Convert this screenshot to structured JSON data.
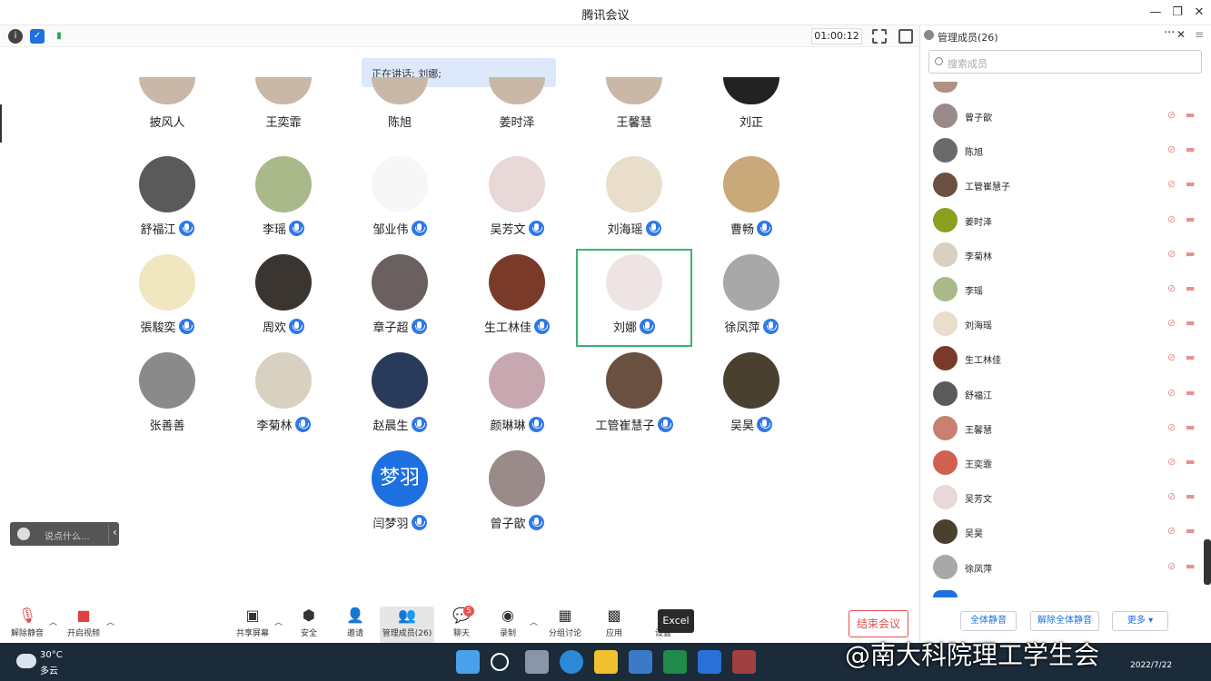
{
  "window": {
    "title": "腾讯会议"
  },
  "toolbar": {
    "timer": "01:00:12"
  },
  "speaking": {
    "text": "正在讲话: 刘娜;"
  },
  "partial_row": [
    {
      "name": "披风人",
      "mic": true
    },
    {
      "name": "王奕霏",
      "mic": true
    },
    {
      "name": "陈旭",
      "mic": true
    },
    {
      "name": "姜时泽",
      "mic": true
    },
    {
      "name": "王馨慧",
      "mic": true
    },
    {
      "name": "刘正",
      "mic": false
    }
  ],
  "grid": [
    {
      "name": "舒福江",
      "mic": true,
      "color": "#5a5a5a"
    },
    {
      "name": "李瑶",
      "mic": true,
      "color": "#a9b98a"
    },
    {
      "name": "邹业伟",
      "mic": true,
      "color": "#f7f7f7"
    },
    {
      "name": "吴芳文",
      "mic": true,
      "color": "#e8d8d8"
    },
    {
      "name": "刘海瑶",
      "mic": true,
      "color": "#e9ddcc"
    },
    {
      "name": "曹畅",
      "mic": true,
      "color": "#c9a87a"
    },
    {
      "name": "張駿奕",
      "mic": true,
      "color": "#f0e6c0"
    },
    {
      "name": "周欢",
      "mic": true,
      "color": "#3a3530"
    },
    {
      "name": "章子超",
      "mic": true,
      "color": "#6a6060"
    },
    {
      "name": "生工林佳",
      "mic": true,
      "color": "#7a3a2a"
    },
    {
      "name": "刘娜",
      "mic": true,
      "color": "#eee4e4"
    },
    {
      "name": "徐凤萍",
      "mic": true,
      "color": "#a8a8a8"
    },
    {
      "name": "张善善",
      "mic": false,
      "color": "#8a8a8a"
    },
    {
      "name": "李菊林",
      "mic": true,
      "color": "#d8d0c0"
    },
    {
      "name": "赵晨生",
      "mic": true,
      "color": "#2a3a5a"
    },
    {
      "name": "颜琳琳",
      "mic": true,
      "color": "#c8a8b0"
    },
    {
      "name": "工管崔慧子",
      "mic": true,
      "color": "#6a5040"
    },
    {
      "name": "吴昊",
      "mic": true,
      "color": "#4a4030"
    },
    {
      "name": "闫梦羽",
      "mic": true,
      "color": "#1e6fe0",
      "initials": "梦羽"
    },
    {
      "name": "曾子歆",
      "mic": true,
      "color": "#9a8a8a"
    }
  ],
  "chat": {
    "placeholder": "说点什么..."
  },
  "bottom": {
    "unmute": "解除静音",
    "video": "开启视频",
    "share": "共享屏幕",
    "security": "安全",
    "invite": "邀请",
    "members": "管理成员(26)",
    "chat": "聊天",
    "chat_badge": "5",
    "record": "录制",
    "breakout": "分组讨论",
    "apps": "应用",
    "settings": "设置",
    "tooltip": "Excel",
    "end": "结束会议"
  },
  "panel": {
    "title": "管理成员(26)",
    "search_placeholder": "搜索成员",
    "members": [
      {
        "name": "曾子歆",
        "color": "#9a8a8a"
      },
      {
        "name": "陈旭",
        "color": "#6a6a6a"
      },
      {
        "name": "工管崔慧子",
        "color": "#6a5040"
      },
      {
        "name": "姜时泽",
        "color": "#8aa020"
      },
      {
        "name": "李菊林",
        "color": "#d8d0c0"
      },
      {
        "name": "李瑶",
        "color": "#a9b98a"
      },
      {
        "name": "刘海瑶",
        "color": "#e9ddcc"
      },
      {
        "name": "生工林佳",
        "color": "#7a3a2a"
      },
      {
        "name": "舒福江",
        "color": "#5a5a5a"
      },
      {
        "name": "王馨慧",
        "color": "#c88070"
      },
      {
        "name": "王奕霏",
        "color": "#d06050"
      },
      {
        "name": "吴芳文",
        "color": "#e8d8d8"
      },
      {
        "name": "吴昊",
        "color": "#4a4030"
      },
      {
        "name": "徐凤萍",
        "color": "#a8a8a8"
      }
    ],
    "mute_all": "全体静音",
    "unmute_all": "解除全体静音",
    "more": "更多 ▾"
  },
  "taskbar": {
    "temp": "30°C",
    "weather": "多云",
    "date": "2022/7/22"
  },
  "watermark": "@南大科院理工学生会"
}
